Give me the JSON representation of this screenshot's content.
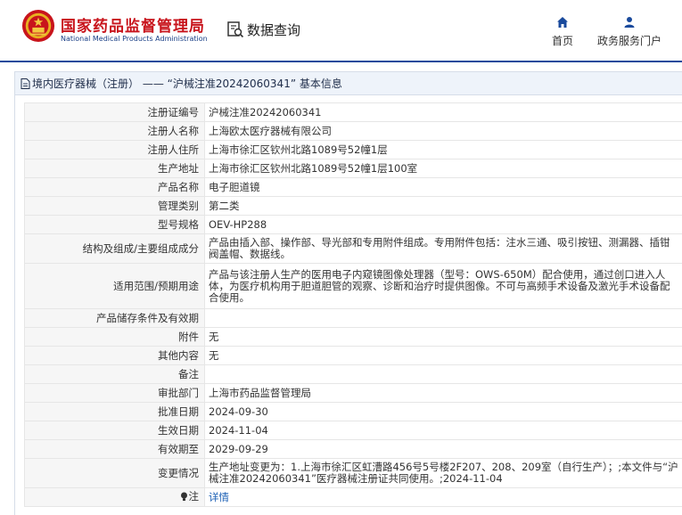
{
  "header": {
    "agency_cn": "国家药品监督管理局",
    "agency_en": "National Medical Products Administration",
    "query_label": "数据查询",
    "nav": [
      {
        "label": "首页",
        "icon": "home-icon"
      },
      {
        "label": "政务服务门户",
        "icon": "user-icon"
      }
    ]
  },
  "panel": {
    "title": "境内医疗器械（注册） —— “沪械注准20242060341” 基本信息"
  },
  "fields": [
    {
      "label": "注册证编号",
      "value": "沪械注准20242060341"
    },
    {
      "label": "注册人名称",
      "value": "上海欧太医疗器械有限公司"
    },
    {
      "label": "注册人住所",
      "value": "上海市徐汇区钦州北路1089号52幢1层"
    },
    {
      "label": "生产地址",
      "value": "上海市徐汇区钦州北路1089号52幢1层100室"
    },
    {
      "label": "产品名称",
      "value": "电子胆道镜"
    },
    {
      "label": "管理类别",
      "value": "第二类"
    },
    {
      "label": "型号规格",
      "value": "OEV-HP288"
    },
    {
      "label": "结构及组成/主要组成成分",
      "value": "产品由插入部、操作部、导光部和专用附件组成。专用附件包括：注水三通、吸引按钮、测漏器、插钳阀盖帽、数据线。"
    },
    {
      "label": "适用范围/预期用途",
      "value": "产品与该注册人生产的医用电子内窥镜图像处理器（型号：OWS-650M）配合使用，通过创口进入人体，为医疗机构用于胆道胆管的观察、诊断和治疗时提供图像。不可与高频手术设备及激光手术设备配合使用。"
    },
    {
      "label": "产品储存条件及有效期",
      "value": ""
    },
    {
      "label": "附件",
      "value": "无"
    },
    {
      "label": "其他内容",
      "value": "无"
    },
    {
      "label": "备注",
      "value": ""
    },
    {
      "label": "审批部门",
      "value": "上海市药品监督管理局"
    },
    {
      "label": "批准日期",
      "value": "2024-09-30"
    },
    {
      "label": "生效日期",
      "value": "2024-11-04"
    },
    {
      "label": "有效期至",
      "value": "2029-09-29"
    },
    {
      "label": "变更情况",
      "value": "生产地址变更为：1.上海市徐汇区虹漕路456号5号楼2F207、208、209室（自行生产）；;本文件与“沪械注准20242060341”医疗器械注册证共同使用。;2024-11-04"
    },
    {
      "label": "注",
      "value": "详情"
    }
  ],
  "colors": {
    "brand_red": "#c8141c",
    "brand_blue": "#1a4a9c",
    "link": "#1a5fb4"
  }
}
